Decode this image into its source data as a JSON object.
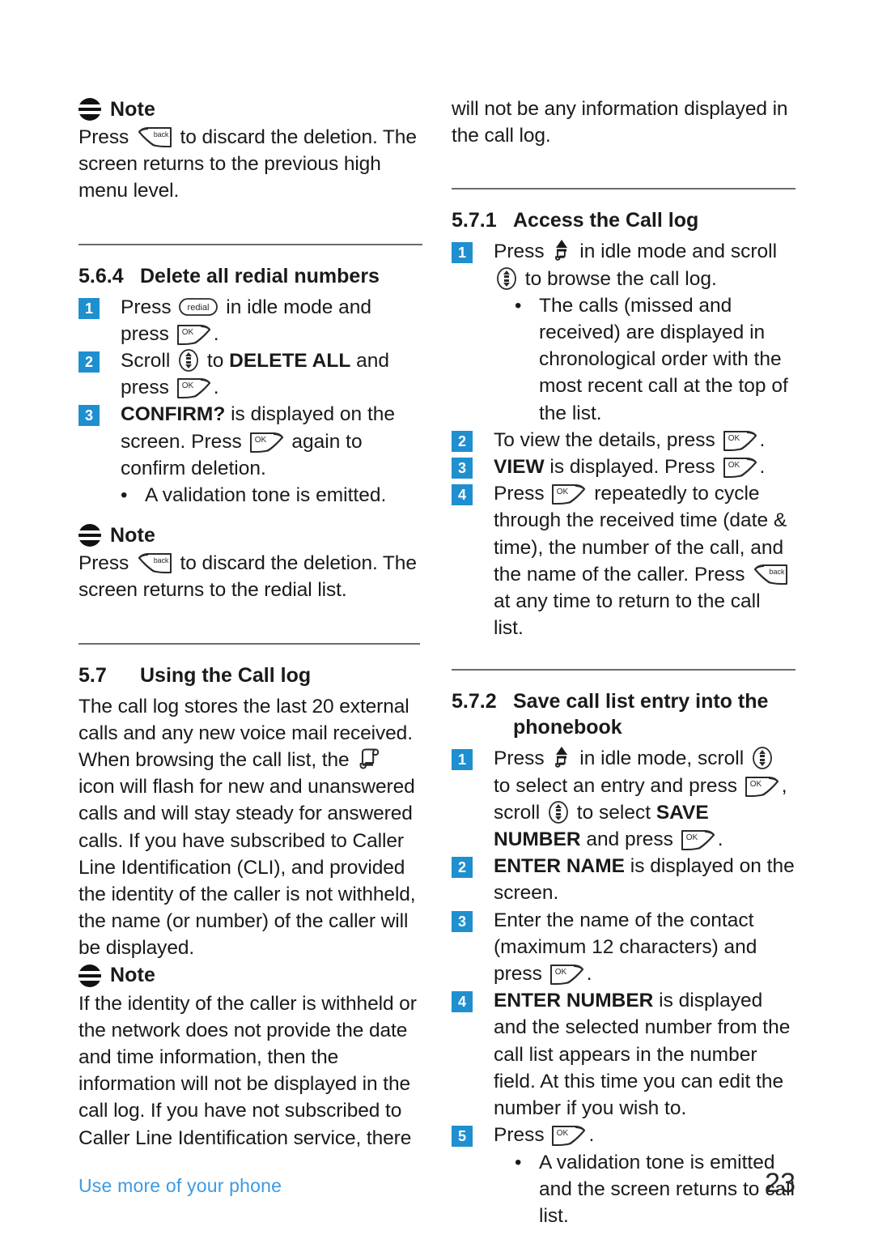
{
  "document": {
    "footer_text": "Use more of your phone",
    "page_number": "23",
    "accent_color": "#1f8fd0",
    "footer_color": "#3d9ae2"
  },
  "icons": {
    "note": "note-icon",
    "ok_key": "ok-softkey-icon",
    "back_key": "back-softkey-icon",
    "redial_key": "redial-key-icon",
    "scroll_key": "scroll-updown-icon",
    "calllog_key": "call-log-key-icon",
    "calllog_doc": "call-log-list-icon",
    "ok_label": "OK",
    "back_label": "back",
    "redial_label": "redial"
  },
  "left_column": {
    "note_1": {
      "title": "Note",
      "text_1": "Press ",
      "text_2": " to discard the deletion. The screen returns to the previous high menu level."
    },
    "section_564": {
      "number": "5.6.4",
      "title": "Delete all redial numbers",
      "steps": [
        {
          "badge": "1",
          "part_1": "Press ",
          "part_2": " in idle mode and press ",
          "part_3": "."
        },
        {
          "badge": "2",
          "part_1": "Scroll ",
          "part_2": " to ",
          "bold_1": "DELETE ALL",
          "part_3": " and press ",
          "part_4": "."
        },
        {
          "badge": "3",
          "bold_1": "CONFIRM?",
          "part_1": " is displayed on the screen. Press ",
          "part_2": " again to confirm deletion."
        }
      ],
      "bullet_1": "A validation tone is emitted."
    },
    "note_2": {
      "title": "Note",
      "text_1": "Press ",
      "text_2": " to discard the deletion. The screen returns to the redial list."
    },
    "section_57": {
      "number": "5.7",
      "title": "Using the Call log",
      "para_1": "The call log stores the last 20 external calls and any new voice mail received. When browsing the call list, the ",
      "para_2": " icon will flash for new and unanswered calls and will stay steady for answered calls. If you have subscribed to Caller Line Identification (CLI), and provided the identity of the caller is not withheld, the name (or number) of the caller will be displayed."
    },
    "note_3": {
      "title": "Note",
      "text_1": "If the identity of the caller is withheld or the network does not provide the date and time information, then the information will not be displayed in the call log. If you have not subscribed to Caller Line Identification service, there"
    }
  },
  "right_column": {
    "continued_para": "will not be any information displayed in the call log.",
    "section_571": {
      "number": "5.7.1",
      "title": "Access the Call log",
      "steps": [
        {
          "badge": "1",
          "part_1": "Press ",
          "part_2": " in idle mode and scroll ",
          "part_3": " to browse the call log."
        },
        {
          "badge": "2",
          "part_1": "To view the details, press ",
          "part_2": "."
        },
        {
          "badge": "3",
          "bold_1": "VIEW",
          "part_1": " is displayed. Press ",
          "part_2": "."
        },
        {
          "badge": "4",
          "part_1": "Press ",
          "part_2": " repeatedly to cycle through the received time (date & time), the number of the call, and the name of the caller. Press ",
          "part_3": " at any time to return to the call list."
        }
      ],
      "bullet_1": "The calls (missed and received) are displayed in chronological order with the most recent call at the top of the list."
    },
    "section_572": {
      "number": "5.7.2",
      "title_line_1": "Save call list entry into the",
      "title_line_2": "phonebook",
      "steps": [
        {
          "badge": "1",
          "part_1": "Press ",
          "part_2": " in idle mode, scroll ",
          "part_3": " to select an entry and press ",
          "part_4": ", scroll ",
          "part_5": " to select ",
          "bold_1": "SAVE NUMBER",
          "part_6": " and press ",
          "part_7": "."
        },
        {
          "badge": "2",
          "bold_1": "ENTER NAME",
          "part_1": " is displayed on the screen."
        },
        {
          "badge": "3",
          "part_1": "Enter the name of the contact (maximum 12 characters) and press ",
          "part_2": "."
        },
        {
          "badge": "4",
          "bold_1": "ENTER NUMBER",
          "part_1": " is displayed and the selected number from the call list appears in the number field. At this time you can edit the number if you wish to."
        },
        {
          "badge": "5",
          "part_1": "Press ",
          "part_2": "."
        }
      ],
      "bullet_1": "A validation tone is emitted and the screen returns to call list."
    }
  }
}
